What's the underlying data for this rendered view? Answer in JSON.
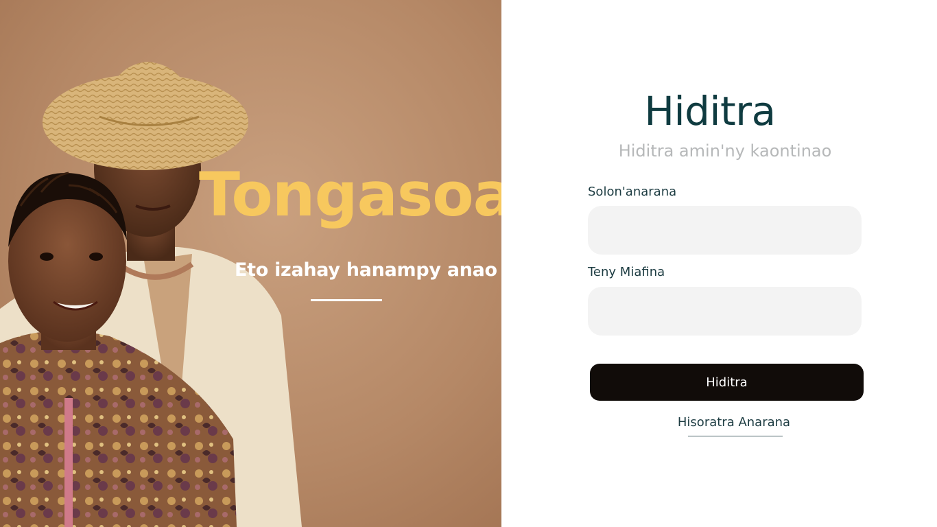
{
  "hero": {
    "title": "Tongasoa",
    "subtitle": "Eto izahay hanampy anao",
    "image_description": "portrait-of-couple"
  },
  "form": {
    "title": "Hiditra",
    "subtitle": "Hiditra amin'ny kaontinao",
    "username_label": "Solon'anarana",
    "username_value": "",
    "username_placeholder": "",
    "password_label": "Teny Miafina",
    "password_value": "",
    "password_placeholder": "",
    "submit_label": "Hiditra",
    "register_label": "Hisoratra Anarana"
  },
  "colors": {
    "hero_title": "#f7c85e",
    "hero_bg": "#b88a68",
    "form_title": "#0f3b40",
    "form_subtitle": "#b6b8b9",
    "input_bg": "#f3f3f3",
    "button_bg": "#110c09",
    "button_text": "#ffffff"
  }
}
